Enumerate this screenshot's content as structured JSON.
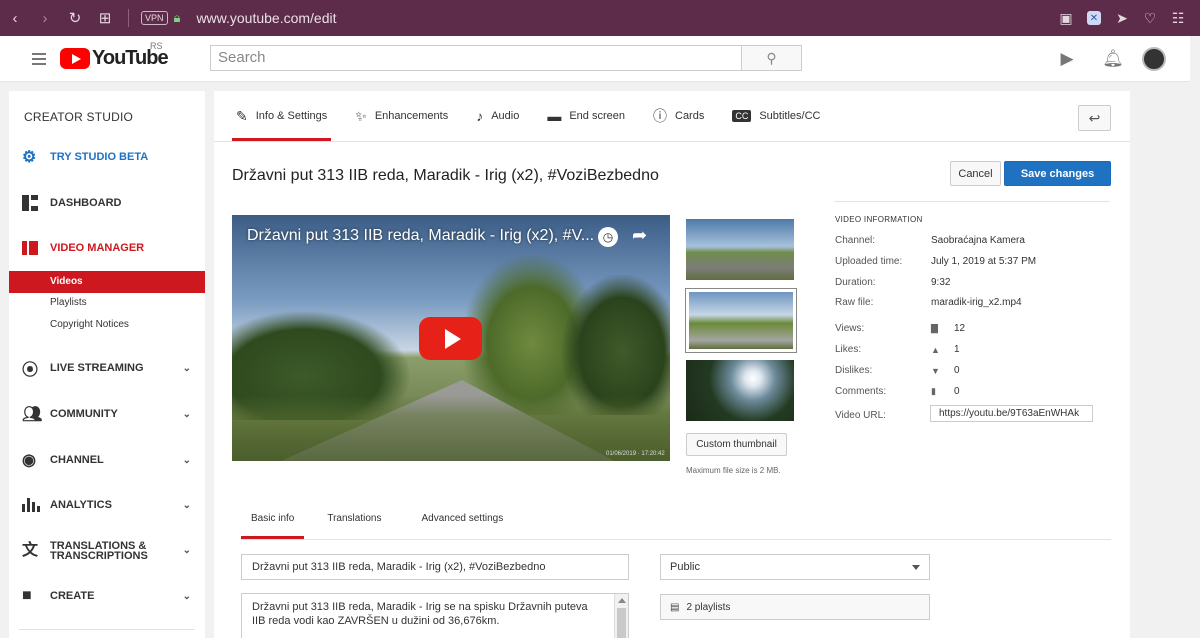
{
  "browser": {
    "vpn_label": "VPN",
    "url": "www.youtube.com/edit"
  },
  "header": {
    "logo_text": "YouTube",
    "logo_region": "RS",
    "search_placeholder": "Search"
  },
  "sidebar": {
    "title": "CREATOR STUDIO",
    "try_beta": "TRY STUDIO BETA",
    "dashboard": "DASHBOARD",
    "video_manager": "VIDEO MANAGER",
    "sub_items": [
      "Videos",
      "Playlists",
      "Copyright Notices"
    ],
    "live_streaming": "LIVE STREAMING",
    "community": "COMMUNITY",
    "channel": "CHANNEL",
    "analytics": "ANALYTICS",
    "translations_line1": "TRANSLATIONS &",
    "translations_line2": "TRANSCRIPTIONS",
    "create": "CREATE"
  },
  "tabs": [
    "Info & Settings",
    "Enhancements",
    "Audio",
    "End screen",
    "Cards",
    "Subtitles/CC"
  ],
  "video": {
    "title": "Državni put 313 IIB reda, Maradik - Irig (x2), #VoziBezbedno",
    "player_title": "Državni put 313 IIB reda, Maradik - Irig (x2), #V...",
    "player_stamp": "01/06/2019 · 17:20:42",
    "cancel_label": "Cancel",
    "save_label": "Save changes",
    "custom_thumbnail_label": "Custom thumbnail",
    "max_file_size": "Maximum file size is 2 MB."
  },
  "video_info": {
    "heading": "VIDEO INFORMATION",
    "channel_label": "Channel:",
    "channel_value": "Saobraćajna Kamera",
    "uploaded_label": "Uploaded time:",
    "uploaded_value": "July 1, 2019 at 5:37 PM",
    "duration_label": "Duration:",
    "duration_value": "9:32",
    "raw_file_label": "Raw file:",
    "raw_file_value": "maradik-irig_x2.mp4",
    "views_label": "Views:",
    "views_value": "12",
    "likes_label": "Likes:",
    "likes_value": "1",
    "dislikes_label": "Dislikes:",
    "dislikes_value": "0",
    "comments_label": "Comments:",
    "comments_value": "0",
    "url_label": "Video URL:",
    "url_value": "https://youtu.be/9T63aEnWHAk"
  },
  "subtabs": [
    "Basic info",
    "Translations",
    "Advanced settings"
  ],
  "form": {
    "title_value": "Državni put 313 IIB reda, Maradik - Irig (x2), #VoziBezbedno",
    "description_value": "Državni put 313 IIB reda, Maradik - Irig se na spisku Državnih puteva IIB reda vodi kao ZAVRŠEN u dužini od 36,676km.",
    "privacy_value": "Public",
    "playlists_value": "2 playlists"
  },
  "colors": {
    "browser_bar": "#5d2c4a",
    "youtube_red": "#cc181e",
    "primary_blue": "#1e72c1"
  }
}
